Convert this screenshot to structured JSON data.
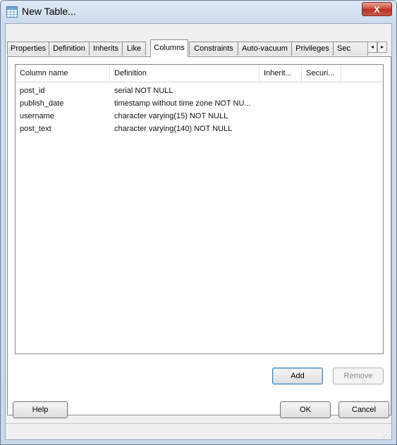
{
  "window": {
    "title": "New Table...",
    "close_label": "X"
  },
  "tabs": [
    {
      "label": "Properties",
      "active": false
    },
    {
      "label": "Definition",
      "active": false
    },
    {
      "label": "Inherits",
      "active": false
    },
    {
      "label": "Like",
      "active": false
    },
    {
      "label": "Columns",
      "active": true
    },
    {
      "label": "Constraints",
      "active": false
    },
    {
      "label": "Auto-vacuum",
      "active": false
    },
    {
      "label": "Privileges",
      "active": false
    },
    {
      "label": "Sec",
      "active": false
    }
  ],
  "tab_scroll": {
    "left": "◂",
    "right": "▸"
  },
  "columns_list": {
    "headers": [
      "Column name",
      "Definition",
      "Inherit...",
      "Securi..."
    ],
    "rows": [
      [
        "post_id",
        "serial NOT NULL",
        "",
        ""
      ],
      [
        "publish_date",
        "timestamp without time zone NOT NU...",
        "",
        ""
      ],
      [
        "username",
        "character varying(15) NOT NULL",
        "",
        ""
      ],
      [
        "post_text",
        "character varying(140) NOT NULL",
        "",
        ""
      ]
    ]
  },
  "panel_buttons": {
    "add": "Add",
    "remove": "Remove"
  },
  "dialog_buttons": {
    "help": "Help",
    "ok": "OK",
    "cancel": "Cancel"
  },
  "status_text": ""
}
